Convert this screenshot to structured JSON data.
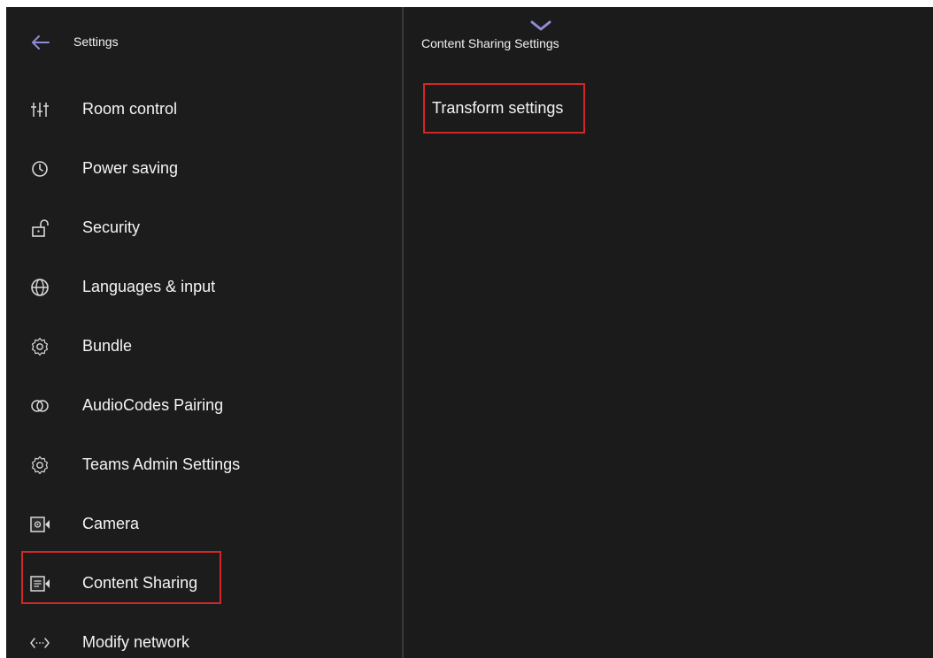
{
  "colors": {
    "background": "#1c1c1c",
    "text": "#f4f4f4",
    "accent": "#8e8bd8",
    "highlight": "#d32626",
    "icon": "#d8d8d8"
  },
  "header": {
    "back_icon": "back-arrow-icon",
    "title": "Settings"
  },
  "sidebar": {
    "items": [
      {
        "label": "Room control",
        "icon": "sliders-icon"
      },
      {
        "label": "Power saving",
        "icon": "clock-icon"
      },
      {
        "label": "Security",
        "icon": "unlock-icon"
      },
      {
        "label": "Languages & input",
        "icon": "globe-icon"
      },
      {
        "label": "Bundle",
        "icon": "gear-icon"
      },
      {
        "label": "AudioCodes Pairing",
        "icon": "pairing-circles-icon"
      },
      {
        "label": "Teams Admin Settings",
        "icon": "gear-icon"
      },
      {
        "label": "Camera",
        "icon": "camera-settings-icon"
      },
      {
        "label": "Content Sharing",
        "icon": "content-camera-icon",
        "selected": true
      },
      {
        "label": "Modify network",
        "icon": "network-code-icon"
      }
    ]
  },
  "main": {
    "title": "Content Sharing Settings",
    "scroll_icon": "chevron-down-icon",
    "items": [
      {
        "label": "Transform settings"
      }
    ]
  }
}
